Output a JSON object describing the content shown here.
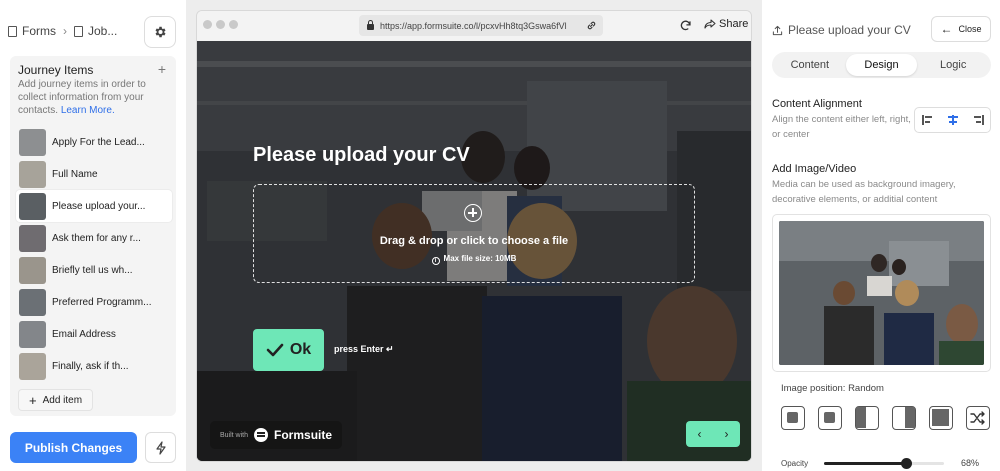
{
  "left": {
    "breadcrumb": [
      "Forms",
      "Job..."
    ],
    "journey": {
      "title": "Journey Items",
      "description": "Add journey items in order to collect information from your contacts.",
      "learn_more": "Learn More.",
      "items": [
        {
          "label": "Apply For the Lead...",
          "thumb": "#8d8f91"
        },
        {
          "label": "Full Name",
          "thumb": "#a7a39a"
        },
        {
          "label": "Please upload your...",
          "thumb": "#5a5f63",
          "active": true
        },
        {
          "label": "Ask them for any r...",
          "thumb": "#6f6c70"
        },
        {
          "label": "Briefly tell us wh...",
          "thumb": "#9a958c"
        },
        {
          "label": "Preferred Programm...",
          "thumb": "#6b7075"
        },
        {
          "label": "Email Address",
          "thumb": "#83868a"
        },
        {
          "label": "Finally, ask if th...",
          "thumb": "#aaa49a"
        }
      ],
      "add_item": "Add item"
    },
    "publish": "Publish Changes"
  },
  "browser": {
    "url": "https://app.formsuite.co/l/pcxvHh8tq3Gswa6fVl",
    "share": "Share"
  },
  "form": {
    "question": "Please upload your CV",
    "drop_text": "Drag & drop or click to choose a file",
    "max_size": "Max file size: 10MB",
    "ok": "Ok",
    "enter_hint": "press Enter ↵",
    "built_with": "Built with",
    "brand": "Formsuite"
  },
  "right": {
    "title": "Please upload your CV",
    "close": "Close",
    "tabs": [
      {
        "label": "Content"
      },
      {
        "label": "Design",
        "active": true
      },
      {
        "label": "Logic"
      }
    ],
    "alignment": {
      "title": "Content Alignment",
      "desc": "Align the content either left, right, or center",
      "selected": "center"
    },
    "media": {
      "title": "Add Image/Video",
      "desc": "Media can be used as background imagery, decorative elements, or additial content"
    },
    "image_position": "Image position: Random",
    "opacity_label": "Opacity",
    "opacity_value": "68%",
    "opacity_fraction": 0.68
  },
  "colors": {
    "accent": "#3b82f6",
    "ok_green": "#6ee7b7"
  }
}
